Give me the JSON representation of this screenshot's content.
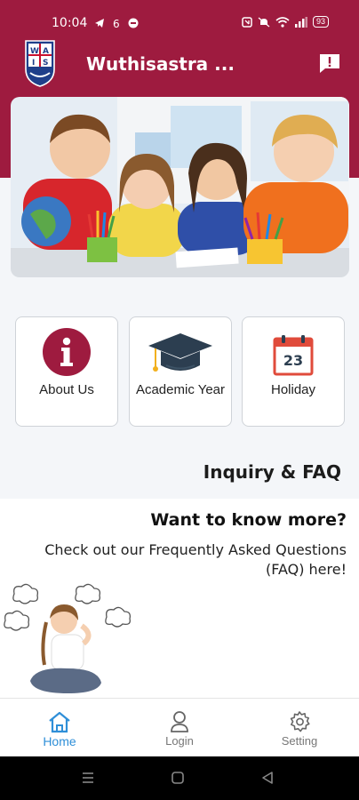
{
  "status_bar": {
    "time": "10:04",
    "battery": "93"
  },
  "app_bar": {
    "title": "Wuthisastra ...",
    "logo_text": "WAIS"
  },
  "tiles": [
    {
      "label": "About Us",
      "icon": "info-icon"
    },
    {
      "label": "Academic Year",
      "icon": "graduation-cap-icon"
    },
    {
      "label": "Holiday",
      "icon": "calendar-icon",
      "icon_text": "23"
    }
  ],
  "inquiry": {
    "title": "Inquiry & FAQ"
  },
  "faq_card": {
    "heading": "Want to know more?",
    "text": "Check out our Frequently Asked Questions (FAQ) here!"
  },
  "bottom_nav": [
    {
      "label": "Home",
      "icon": "home-icon",
      "active": true
    },
    {
      "label": "Login",
      "icon": "user-icon",
      "active": false
    },
    {
      "label": "Setting",
      "icon": "gear-icon",
      "active": false
    }
  ],
  "colors": {
    "primary": "#9e1b3f",
    "active_tab": "#2f8fd8",
    "background": "#f4f6f9"
  }
}
